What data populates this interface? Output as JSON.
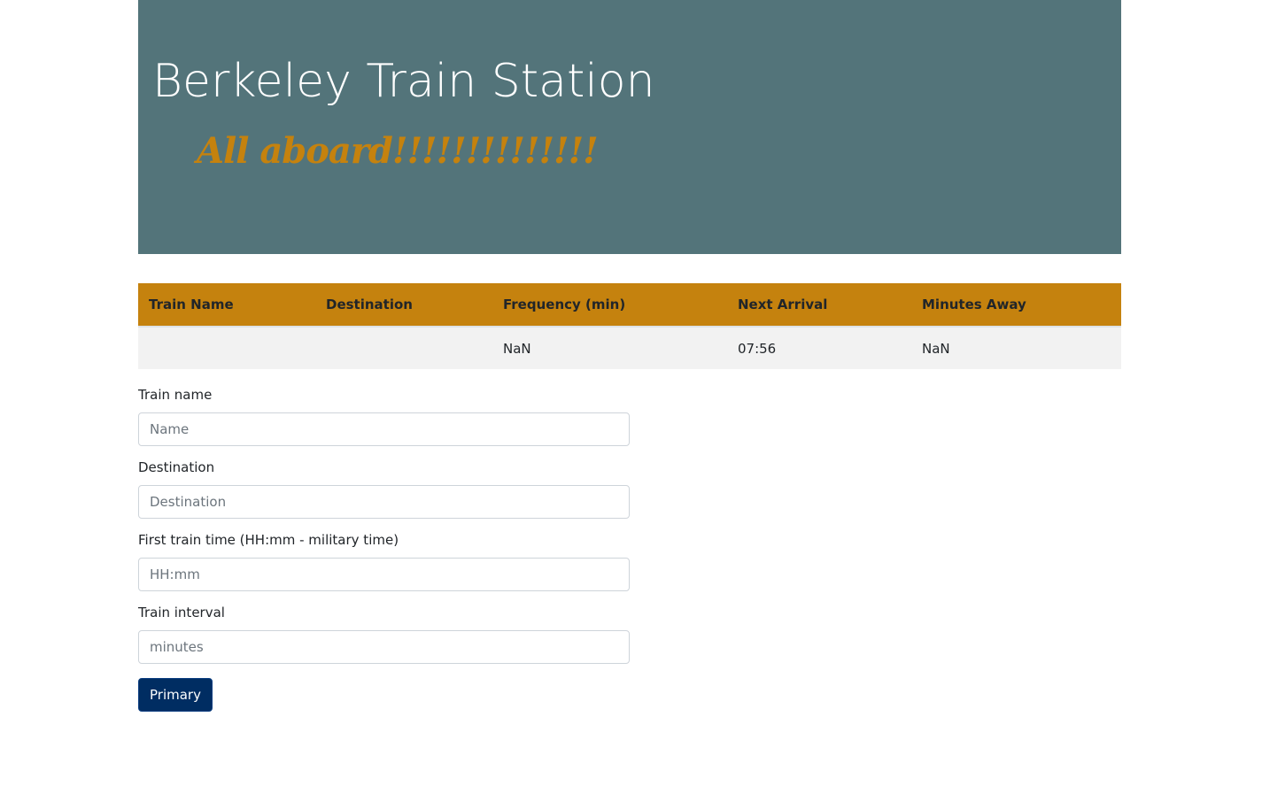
{
  "header": {
    "title": "Berkeley Train Station",
    "tagline": "All aboard!!!!!!!!!!!!!!"
  },
  "table": {
    "columns": [
      "Train Name",
      "Destination",
      "Frequency (min)",
      "Next Arrival",
      "Minutes Away"
    ],
    "rows": [
      [
        "",
        "",
        "NaN",
        "07:56",
        "NaN"
      ]
    ]
  },
  "form": {
    "train_name": {
      "label": "Train name",
      "placeholder": "Name"
    },
    "destination": {
      "label": "Destination",
      "placeholder": "Destination"
    },
    "first_time": {
      "label": "First train time (HH:mm - military time)",
      "placeholder": "HH:mm"
    },
    "interval": {
      "label": "Train interval",
      "placeholder": "minutes"
    },
    "submit_label": "Primary"
  },
  "colors": {
    "jumbotron_bg": "#53747a",
    "accent": "#c5820e",
    "button_bg": "#002d62",
    "row_bg": "#f2f2f2"
  }
}
